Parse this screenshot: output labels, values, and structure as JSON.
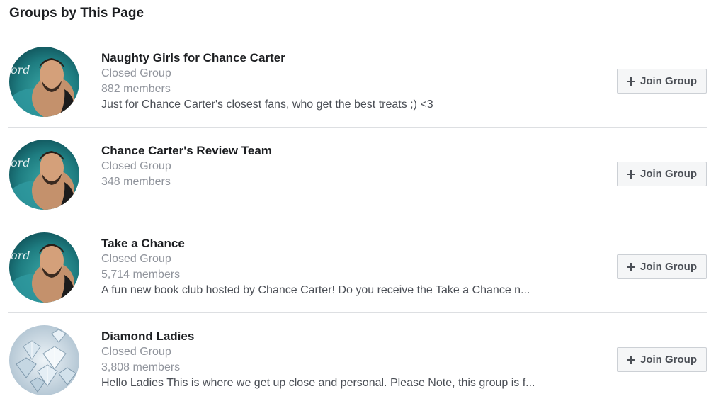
{
  "header": {
    "title": "Groups by This Page"
  },
  "groups": [
    {
      "name": "Naughty Girls for Chance Carter",
      "type": "Closed Group",
      "members": "882 members",
      "description": "Just for Chance Carter's closest fans, who get the best treats ;) <3",
      "avatar": "man-portrait-teal",
      "join_label": "Join Group"
    },
    {
      "name": "Chance Carter's Review Team",
      "type": "Closed Group",
      "members": "348 members",
      "description": "",
      "avatar": "man-portrait-teal",
      "join_label": "Join Group"
    },
    {
      "name": "Take a Chance",
      "type": "Closed Group",
      "members": "5,714 members",
      "description": "A fun new book club hosted by Chance Carter! Do you receive the Take a Chance n...",
      "avatar": "man-portrait-teal",
      "join_label": "Join Group"
    },
    {
      "name": "Diamond Ladies",
      "type": "Closed Group",
      "members": "3,808 members",
      "description": "Hello Ladies This is where we get up close and personal. Please Note, this group is f...",
      "avatar": "diamonds",
      "join_label": "Join Group"
    }
  ],
  "colors": {
    "title_text": "#1c1e21",
    "meta_text": "#90949c",
    "desc_text": "#4b4f56",
    "divider": "#dddfe2",
    "button_bg": "#f5f6f7",
    "button_border": "#ccd0d5"
  }
}
